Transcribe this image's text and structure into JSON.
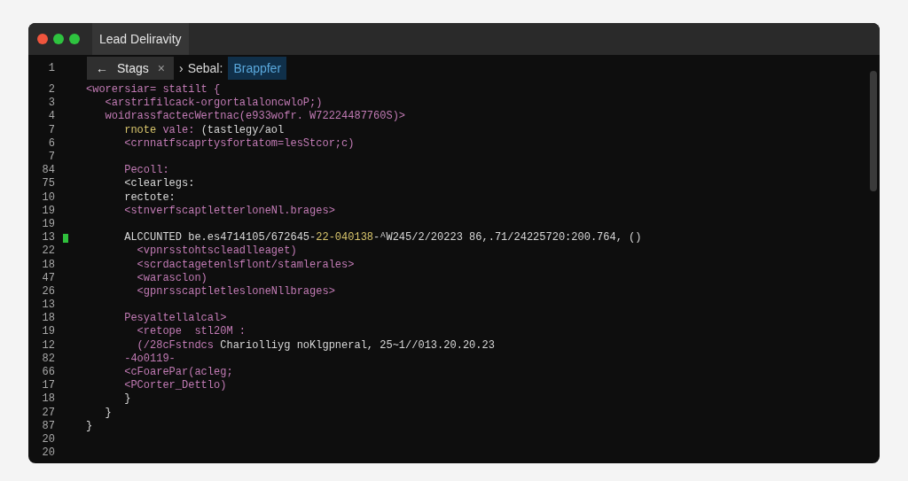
{
  "window": {
    "title": "Lead Deliravity"
  },
  "tab_bar": {
    "line_number": "1",
    "tabs": [
      {
        "back": "←",
        "label": "Stags",
        "close": "×",
        "selected": true
      }
    ],
    "breadcrumb": {
      "separator": "›",
      "label": "Sebal:",
      "highlight": "Brappfer"
    }
  },
  "lines": [
    {
      "number": "2",
      "marker": false,
      "segments": [
        {
          "text": "<worersiar= statilt {",
          "color": "#c27bb5"
        }
      ]
    },
    {
      "number": "3",
      "marker": false,
      "segments": [
        {
          "text": "   <arstrifilcack-orgortalaloncwloP;)",
          "color": "#c27bb5"
        }
      ]
    },
    {
      "number": "4",
      "marker": false,
      "segments": [
        {
          "text": "   woidrassfactecWertnac(e933wofr. W72224487760S)>",
          "color": "#c27bb5"
        }
      ]
    },
    {
      "number": "7",
      "marker": false,
      "segments": [
        {
          "text": "      rnote ",
          "color": "#d8c56c"
        },
        {
          "text": "vale: ",
          "color": "#c27bb5"
        },
        {
          "text": "(tastlegy/aol",
          "color": "#d8d8d8"
        }
      ]
    },
    {
      "number": "6",
      "marker": false,
      "segments": [
        {
          "text": "      <crnnatfscaprtysfortatom=lesStcor;c)",
          "color": "#c27bb5"
        }
      ]
    },
    {
      "number": "7",
      "marker": false
    },
    {
      "number": "84",
      "marker": false,
      "segments": [
        {
          "text": "      Pecoll:",
          "color": "#c27bb5"
        }
      ]
    },
    {
      "number": "75",
      "marker": false,
      "segments": [
        {
          "text": "      <clearlegs:",
          "color": "#d8d8d8"
        }
      ]
    },
    {
      "number": "10",
      "marker": false,
      "segments": [
        {
          "text": "      rectote:",
          "color": "#d8d8d8"
        }
      ]
    },
    {
      "number": "19",
      "marker": false,
      "segments": [
        {
          "text": "      <stnverfscaptletterloneNl.brages>",
          "color": "#c27bb5"
        }
      ]
    },
    {
      "number": "19",
      "marker": false
    },
    {
      "number": "13",
      "marker": true,
      "segments": [
        {
          "text": "      ALCCUNTED be.es4714105/672645-",
          "color": "#d8d8d8"
        },
        {
          "text": "22-040138",
          "color": "#d8c56c"
        },
        {
          "text": "-ᴬW245/2/20223 86,.71/24225720:200.764, ()",
          "color": "#d8d8d8"
        }
      ]
    },
    {
      "number": "22",
      "marker": false,
      "segments": [
        {
          "text": "        <vpnrsstohtscleadlleaget)",
          "color": "#c27bb5"
        }
      ]
    },
    {
      "number": "18",
      "marker": false,
      "segments": [
        {
          "text": "        <scrdactagetenlsflont/stamlerales>",
          "color": "#c27bb5"
        }
      ]
    },
    {
      "number": "47",
      "marker": false,
      "segments": [
        {
          "text": "        <warasclon)",
          "color": "#c27bb5"
        }
      ]
    },
    {
      "number": "26",
      "marker": false,
      "segments": [
        {
          "text": "        <gpnrsscaptletlesloneNllbrages>",
          "color": "#c27bb5"
        }
      ]
    },
    {
      "number": "13",
      "marker": false
    },
    {
      "number": "18",
      "marker": false,
      "segments": [
        {
          "text": "      Pesyaltellalcal>",
          "color": "#c27bb5"
        }
      ]
    },
    {
      "number": "19",
      "marker": false,
      "segments": [
        {
          "text": "        <retope  stl20M :",
          "color": "#c27bb5"
        }
      ]
    },
    {
      "number": "12",
      "marker": false,
      "segments": [
        {
          "text": "        (/28cFstndcs ",
          "color": "#c27bb5"
        },
        {
          "text": "Chariolliyg noKlgpneral, 25~1//013.20.20.23",
          "color": "#d8d8d8"
        }
      ]
    },
    {
      "number": "82",
      "marker": false,
      "segments": [
        {
          "text": "      -4o0119-",
          "color": "#c27bb5"
        }
      ]
    },
    {
      "number": "66",
      "marker": false,
      "segments": [
        {
          "text": "      <cFoarePar(acleg;",
          "color": "#c27bb5"
        }
      ]
    },
    {
      "number": "17",
      "marker": false,
      "segments": [
        {
          "text": "      <PCorter_Dettlo)",
          "color": "#c27bb5"
        }
      ]
    },
    {
      "number": "18",
      "marker": false,
      "segments": [
        {
          "text": "      }",
          "color": "#d8d8d8"
        }
      ]
    },
    {
      "number": "27",
      "marker": false,
      "segments": [
        {
          "text": "   }",
          "color": "#d8d8d8"
        }
      ]
    },
    {
      "number": "87",
      "marker": false,
      "segments": [
        {
          "text": "}",
          "color": "#d8d8d8"
        }
      ]
    },
    {
      "number": "20",
      "marker": false
    },
    {
      "number": "20",
      "marker": false
    }
  ]
}
